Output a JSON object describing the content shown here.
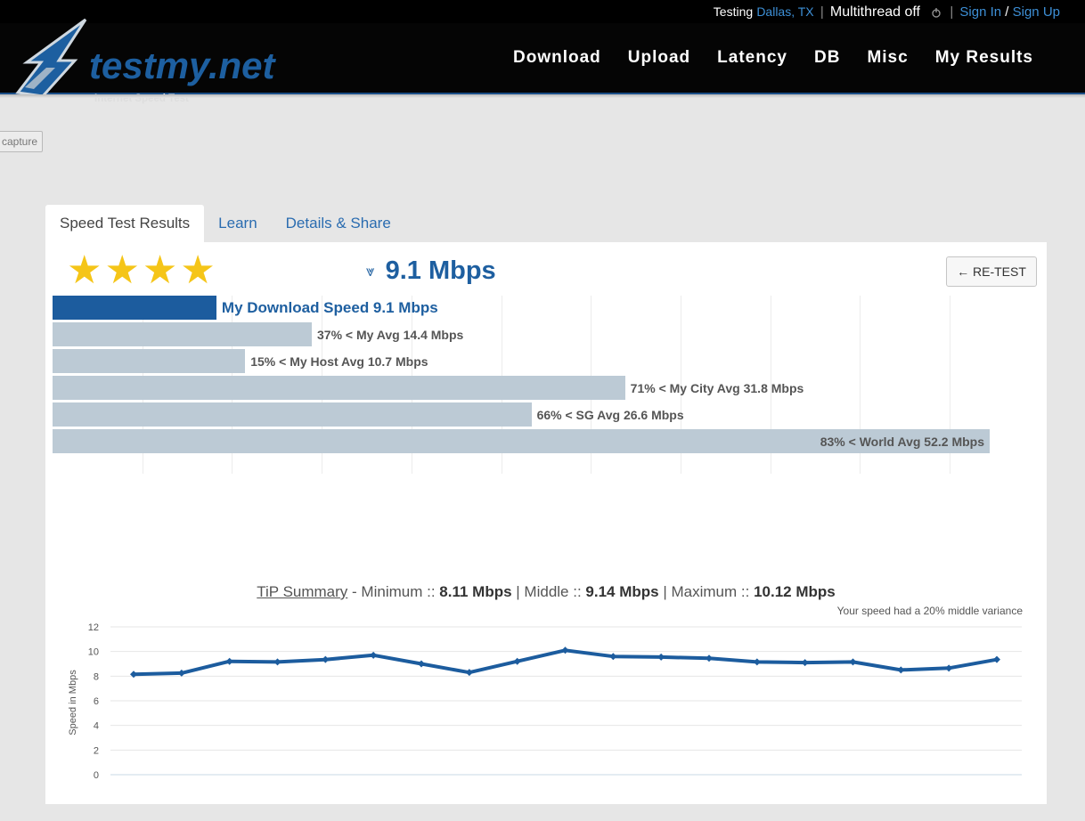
{
  "topbar": {
    "testing_label": "Testing",
    "location": "Dallas, TX",
    "multithread": "Multithread off",
    "sign_in": "Sign In",
    "slash": "/",
    "sign_up": "Sign Up"
  },
  "logo": {
    "name": "testmy.net",
    "tagline": "Internet Speed Test"
  },
  "nav": {
    "items": [
      "Download",
      "Upload",
      "Latency",
      "DB",
      "Misc",
      "My Results"
    ]
  },
  "capture_label": "capture",
  "tabs": [
    "Speed Test Results",
    "Learn",
    "Details & Share"
  ],
  "rating": {
    "stars": 4
  },
  "speed": {
    "arrow": "⩔",
    "value": "9.1 Mbps"
  },
  "retest_label": "← RE-TEST",
  "colors": {
    "primary": "#1c5c9e",
    "bar": "#bccad5",
    "star": "#f5c518",
    "link": "#3d8fd6"
  },
  "chart_data": [
    {
      "type": "bar",
      "orientation": "horizontal",
      "categories": [
        "My Download Speed",
        "My Avg",
        "My Host Avg",
        "My City Avg",
        "SG Avg",
        "World Avg"
      ],
      "values": [
        9.1,
        14.4,
        10.7,
        31.8,
        26.6,
        52.2
      ],
      "labels": [
        "My Download Speed 9.1 Mbps",
        "37% < My Avg 14.4 Mbps",
        "15% < My Host Avg 10.7 Mbps",
        "71% < My City Avg 31.8 Mbps",
        "66% < SG Avg 26.6 Mbps",
        "83% < World Avg 52.2 Mbps"
      ],
      "xlim": [
        0,
        55
      ]
    },
    {
      "type": "line",
      "ylabel": "Speed in Mbps",
      "ylim": [
        0,
        12
      ],
      "yticks": [
        0,
        2,
        4,
        6,
        8,
        10,
        12
      ],
      "grid": true,
      "series": [
        {
          "values": [
            8.15,
            8.25,
            9.2,
            9.15,
            9.35,
            9.7,
            9.0,
            8.3,
            9.2,
            10.1,
            9.6,
            9.55,
            9.45,
            9.15,
            9.1,
            9.15,
            8.5,
            8.65,
            9.35
          ]
        }
      ]
    }
  ],
  "tip": {
    "title": "TiP Summary",
    "min_label": "- Minimum ::",
    "min": "8.11 Mbps",
    "mid_label": "| Middle ::",
    "mid": "9.14 Mbps",
    "max_label": "| Maximum ::",
    "max": "10.12 Mbps",
    "variance": "Your speed had a 20% middle variance"
  }
}
